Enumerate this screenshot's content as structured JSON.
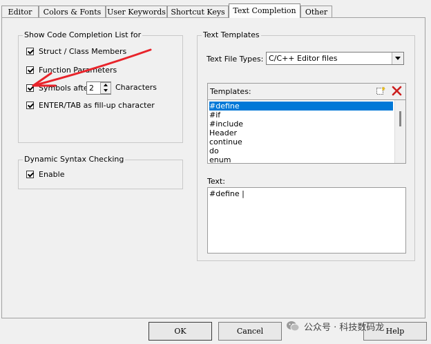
{
  "tabs": [
    {
      "label": "Editor",
      "active": false
    },
    {
      "label": "Colors & Fonts",
      "active": false
    },
    {
      "label": "User Keywords",
      "active": false
    },
    {
      "label": "Shortcut Keys",
      "active": false
    },
    {
      "label": "Text Completion",
      "active": true
    },
    {
      "label": "Other",
      "active": false
    }
  ],
  "completion": {
    "legend": "Show Code Completion List for",
    "struct_label": "Struct / Class Members",
    "function_label": "Function Parameters",
    "symbols_label": "Symbols after",
    "symbols_value": "2",
    "characters_label": "Characters",
    "enter_tab_label": "ENTER/TAB as fill-up character"
  },
  "syntax": {
    "legend": "Dynamic Syntax Checking",
    "enable_label": "Enable"
  },
  "templates": {
    "legend": "Text Templates",
    "file_types_label": "Text File Types:",
    "file_type_value": "C/C++ Editor files",
    "list_header": "Templates:",
    "items": [
      "#define",
      "#if",
      "#include",
      "Header",
      "continue",
      "do",
      "enum"
    ],
    "selected_index": 0,
    "text_label": "Text:",
    "text_value": "#define |"
  },
  "buttons": {
    "ok": "OK",
    "cancel": "Cancel",
    "help": "Help"
  },
  "watermark": "公众号 · 科技数码龙",
  "colors": {
    "selection": "#0078d7",
    "annotation_arrow": "#e8242b"
  }
}
